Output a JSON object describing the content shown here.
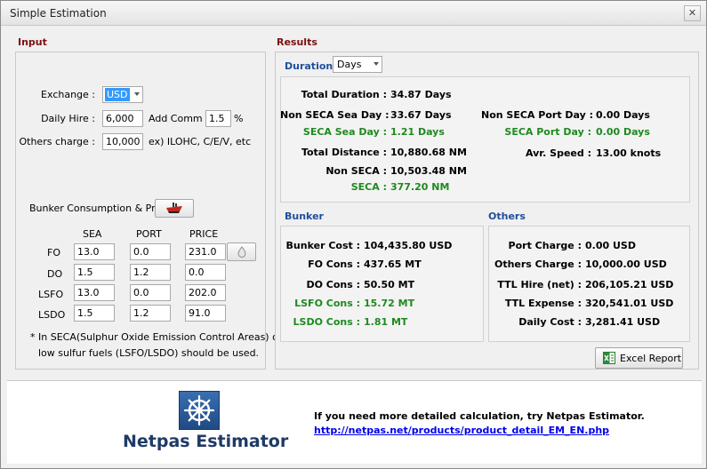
{
  "window": {
    "title": "Simple Estimation",
    "close_label": "✕"
  },
  "input": {
    "heading": "Input",
    "exchange_label": "Exchange :",
    "exchange_value": "USD",
    "daily_hire_label": "Daily Hire :",
    "daily_hire_value": "6,000",
    "add_comm_label": "Add Comm :",
    "add_comm_value": "1.5",
    "percent": "%",
    "others_label": "Others charge :",
    "others_value": "10,000",
    "others_note": "ex) ILOHC, C/E/V, etc",
    "bunker_label": "Bunker Consumption & Price",
    "col_sea": "SEA",
    "col_port": "PORT",
    "col_price": "PRICE",
    "rows": [
      {
        "label": "FO",
        "sea": "13.0",
        "port": "0.0",
        "price": "231.0"
      },
      {
        "label": "DO",
        "sea": "1.5",
        "port": "1.2",
        "price": "0.0"
      },
      {
        "label": "LSFO",
        "sea": "13.0",
        "port": "0.0",
        "price": "202.0"
      },
      {
        "label": "LSDO",
        "sea": "1.5",
        "port": "1.2",
        "price": "91.0"
      }
    ],
    "note_line1": "* In SECA(Sulphur Oxide Emission Control Areas) only",
    "note_line2": "low sulfur fuels (LSFO/LSDO) should be used."
  },
  "results": {
    "heading": "Results",
    "duration_heading": "Duration",
    "duration_unit": "Days",
    "total_duration_label": "Total Duration :",
    "total_duration_value": "34.87 Days",
    "non_seca_sea_label": "Non SECA Sea Day :",
    "non_seca_sea_value": "33.67 Days",
    "seca_sea_label": "SECA Sea Day :",
    "seca_sea_value": "1.21 Days",
    "non_seca_port_label": "Non SECA Port Day :",
    "non_seca_port_value": "0.00 Days",
    "seca_port_label": "SECA Port Day :",
    "seca_port_value": "0.00 Days",
    "total_distance_label": "Total Distance :",
    "total_distance_value": "10,880.68 NM",
    "avr_speed_label": "Avr. Speed :",
    "avr_speed_value": "13.00 knots",
    "non_seca_label": "Non SECA :",
    "non_seca_value": "10,503.48 NM",
    "seca_label": "SECA :",
    "seca_value": "377.20 NM",
    "bunker_heading": "Bunker",
    "bunker_cost_label": "Bunker Cost :",
    "bunker_cost_value": "104,435.80 USD",
    "fo_cons_label": "FO Cons :",
    "fo_cons_value": "437.65 MT",
    "do_cons_label": "DO Cons :",
    "do_cons_value": "50.50 MT",
    "lsfo_cons_label": "LSFO Cons :",
    "lsfo_cons_value": "15.72 MT",
    "lsdo_cons_label": "LSDO Cons :",
    "lsdo_cons_value": "1.81 MT",
    "others_heading": "Others",
    "port_charge_label": "Port Charge :",
    "port_charge_value": "0.00 USD",
    "others_charge_label": "Others Charge :",
    "others_charge_value": "10,000.00 USD",
    "ttl_hire_label": "TTL Hire (net) :",
    "ttl_hire_value": "206,105.21 USD",
    "ttl_expense_label": "TTL Expense :",
    "ttl_expense_value": "320,541.01 USD",
    "daily_cost_label": "Daily Cost :",
    "daily_cost_value": "3,281.41 USD",
    "excel_button": "Excel Report"
  },
  "footer": {
    "brand": "Netpas Estimator",
    "promo_text": "If you need more detailed calculation, try Netpas Estimator.",
    "link_text": "http://netpas.net/products/product_detail_EM_EN.php"
  },
  "colors": {
    "section_title": "#7a1010",
    "blue_heading": "#1f4e9b",
    "seca_green": "#1e8a1e",
    "link_blue": "#0000ee",
    "brand_navy": "#1f3a66"
  }
}
